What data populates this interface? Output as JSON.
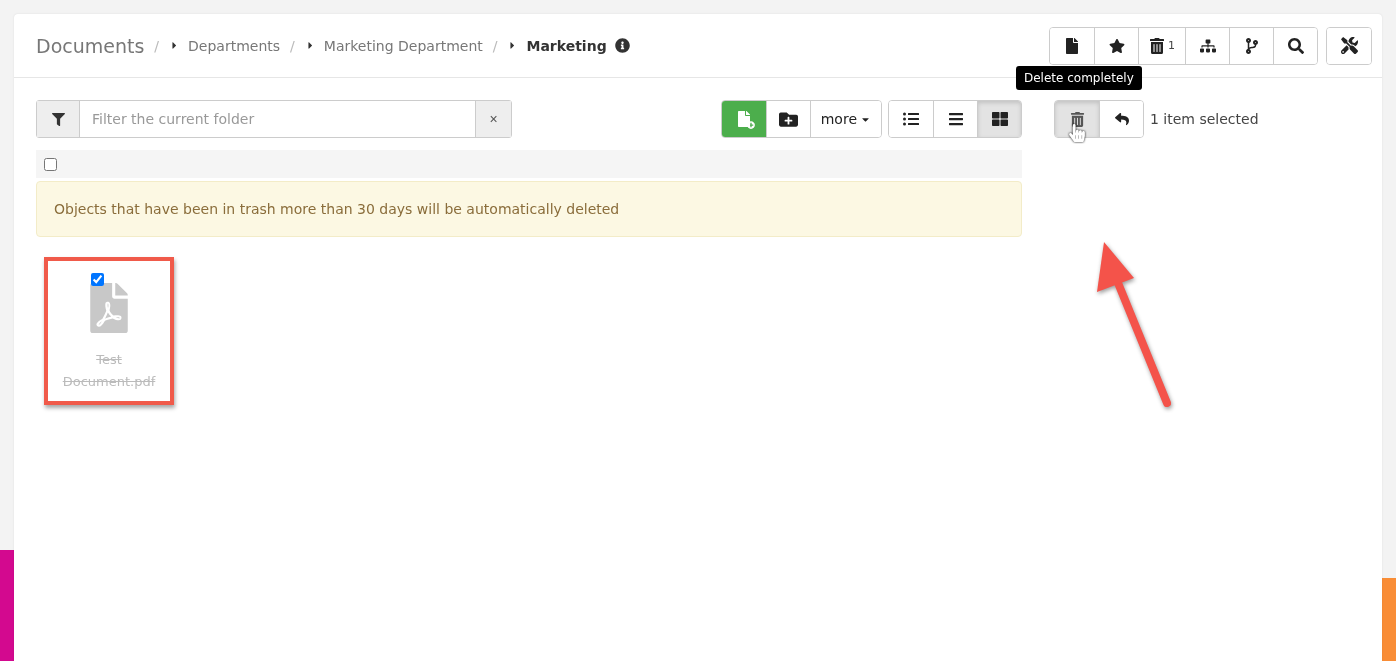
{
  "breadcrumb": {
    "root": "Documents",
    "items": [
      {
        "separator": "/",
        "label": "Departments",
        "current": false
      },
      {
        "separator": "/",
        "label": "Marketing Department",
        "current": false
      },
      {
        "separator": "/",
        "label": "Marketing",
        "current": true
      }
    ]
  },
  "header_tools": [
    {
      "kind": "file"
    },
    {
      "kind": "star"
    },
    {
      "kind": "trash",
      "count": "1"
    },
    {
      "kind": "tree"
    },
    {
      "kind": "branch"
    },
    {
      "kind": "search"
    }
  ],
  "settings_tool": {
    "kind": "tools"
  },
  "filter": {
    "placeholder": "Filter the current folder",
    "clear": "×"
  },
  "actions": [
    {
      "kind": "new-file",
      "primary": true
    },
    {
      "kind": "new-folder",
      "primary": false
    },
    {
      "kind": "more",
      "label": "more",
      "primary": false
    }
  ],
  "views": [
    {
      "kind": "details",
      "selected": false
    },
    {
      "kind": "list",
      "selected": false
    },
    {
      "kind": "grid",
      "selected": true
    }
  ],
  "select_all": {
    "checked": false
  },
  "alert": "Objects that have been in trash more than 30 days will be automatically deleted",
  "files": [
    {
      "name": "Test Document.pdf",
      "checked": true,
      "deleted": true,
      "highlighted": true
    }
  ],
  "selection": {
    "tooltip": "Delete completely",
    "count": "1 item selected"
  }
}
